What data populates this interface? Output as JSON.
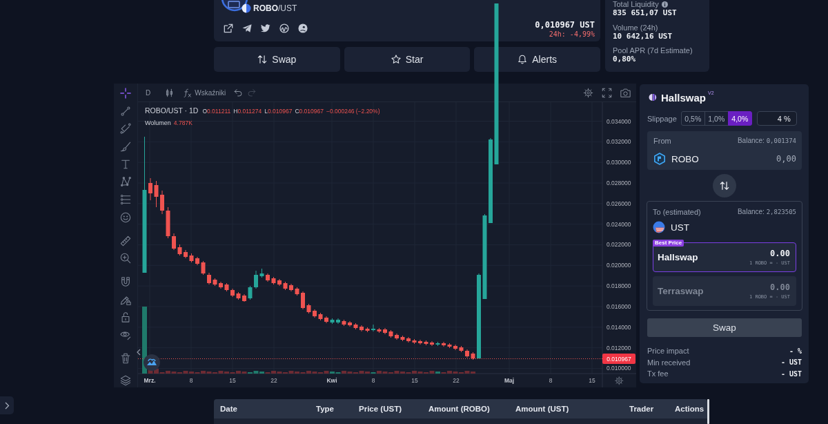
{
  "header": {
    "pair": "**ROBO**/UST",
    "price": "0,010967 UST",
    "change": "24h: -4,99%"
  },
  "actions": [
    {
      "label": "Swap",
      "kind": "swap"
    },
    {
      "label": "Star",
      "kind": "star"
    },
    {
      "label": "Alerts",
      "kind": "alerts"
    }
  ],
  "stats": [
    {
      "label": "Total Liquidity",
      "value": "835 651,07 UST",
      "info": true
    },
    {
      "label": "Volume (24h)",
      "value": "10 642,16 UST",
      "info": false
    },
    {
      "label": "Pool APR (7d Estimate)",
      "value": "0,80%",
      "info": false
    }
  ],
  "chart": {
    "tools": [
      {
        "kind": "crosshair",
        "selected": true
      },
      {
        "kind": "trend-line",
        "selected": false
      },
      {
        "kind": "pitchfork",
        "selected": false
      },
      {
        "kind": "brush",
        "selected": false
      },
      {
        "kind": "text",
        "selected": false
      },
      {
        "kind": "pattern",
        "selected": false
      },
      {
        "kind": "fib-lines",
        "selected": false
      },
      {
        "kind": "emoji",
        "selected": false
      },
      {
        "kind": "ruler",
        "selected": false
      },
      {
        "kind": "zoom-in",
        "selected": false
      },
      {
        "kind": "magnet",
        "selected": false
      },
      {
        "kind": "lock-drawing",
        "selected": false
      },
      {
        "kind": "lock",
        "selected": false
      },
      {
        "kind": "eye",
        "selected": false
      },
      {
        "kind": "trash",
        "selected": false
      },
      {
        "kind": "layers",
        "selected": false
      }
    ],
    "toolbar": {
      "interval": "D",
      "indicators": "Wskaźniki",
      "history": [
        {
          "kind": "undo",
          "disabled": false
        },
        {
          "kind": "redo",
          "disabled": true
        }
      ]
    },
    "legend": {
      "title": "ROBO/UST · 1D",
      "ohlc": [
        {
          "key": "O",
          "value": "0.011211"
        },
        {
          "key": "H",
          "value": "0.011274"
        },
        {
          "key": "L",
          "value": "0.010967"
        },
        {
          "key": "C",
          "value": "0.010967"
        }
      ],
      "change": "−0.000246 (−2.20%)",
      "volume_label": "Wolumen",
      "volume_value": "4.787K"
    },
    "price_ticks": [
      "0.034000",
      "0.032000",
      "0.030000",
      "0.028000",
      "0.026000",
      "0.024000",
      "0.022000",
      "0.020000",
      "0.018000",
      "0.016000",
      "0.014000",
      "0.012000",
      "0.010000"
    ],
    "last_price": "0.010967",
    "time_labels": [
      {
        "label": "Mrz.",
        "kind": "month"
      },
      {
        "label": "8",
        "kind": "day"
      },
      {
        "label": "15",
        "kind": "day"
      },
      {
        "label": "22",
        "kind": "day"
      },
      {
        "label": "Kwi",
        "kind": "month"
      },
      {
        "label": "8",
        "kind": "day"
      },
      {
        "label": "15",
        "kind": "day"
      },
      {
        "label": "22",
        "kind": "day"
      },
      {
        "label": "Maj",
        "kind": "month"
      },
      {
        "label": "8",
        "kind": "day"
      },
      {
        "label": "15",
        "kind": "day"
      }
    ]
  },
  "swap": {
    "title": "Hallswap",
    "version": "V2",
    "slippage": {
      "label": "Slippage",
      "options": [
        {
          "label": "0,5%",
          "selected": false
        },
        {
          "label": "1,0%",
          "selected": false
        },
        {
          "label": "4,0%",
          "selected": true
        }
      ],
      "custom": "4 %"
    },
    "from": {
      "label": "From",
      "balance_label": "Balance:",
      "balance": "0,001374",
      "token": "ROBO",
      "amount": "0,00"
    },
    "to": {
      "label": "To (estimated)",
      "balance_label": "Balance:",
      "balance": "2,823505",
      "token": "UST"
    },
    "routes": [
      {
        "name": "Hallswap",
        "amount": "0.00",
        "rate": "1 ROBO = - UST",
        "selected": true,
        "badge": "Best Price"
      },
      {
        "name": "Terraswap",
        "amount": "0.00",
        "rate": "1 ROBO = - UST",
        "selected": false
      }
    ],
    "submit": "Swap",
    "details": [
      {
        "label": "Price impact",
        "value": "- %"
      },
      {
        "label": "Min received",
        "value": "- UST"
      },
      {
        "label": "Tx fee",
        "value": "- UST"
      }
    ]
  },
  "trades_table": {
    "columns": [
      "Date",
      "Type",
      "Price (UST)",
      "Amount (ROBO)",
      "Amount (UST)",
      "Trader",
      "Actions"
    ]
  }
}
